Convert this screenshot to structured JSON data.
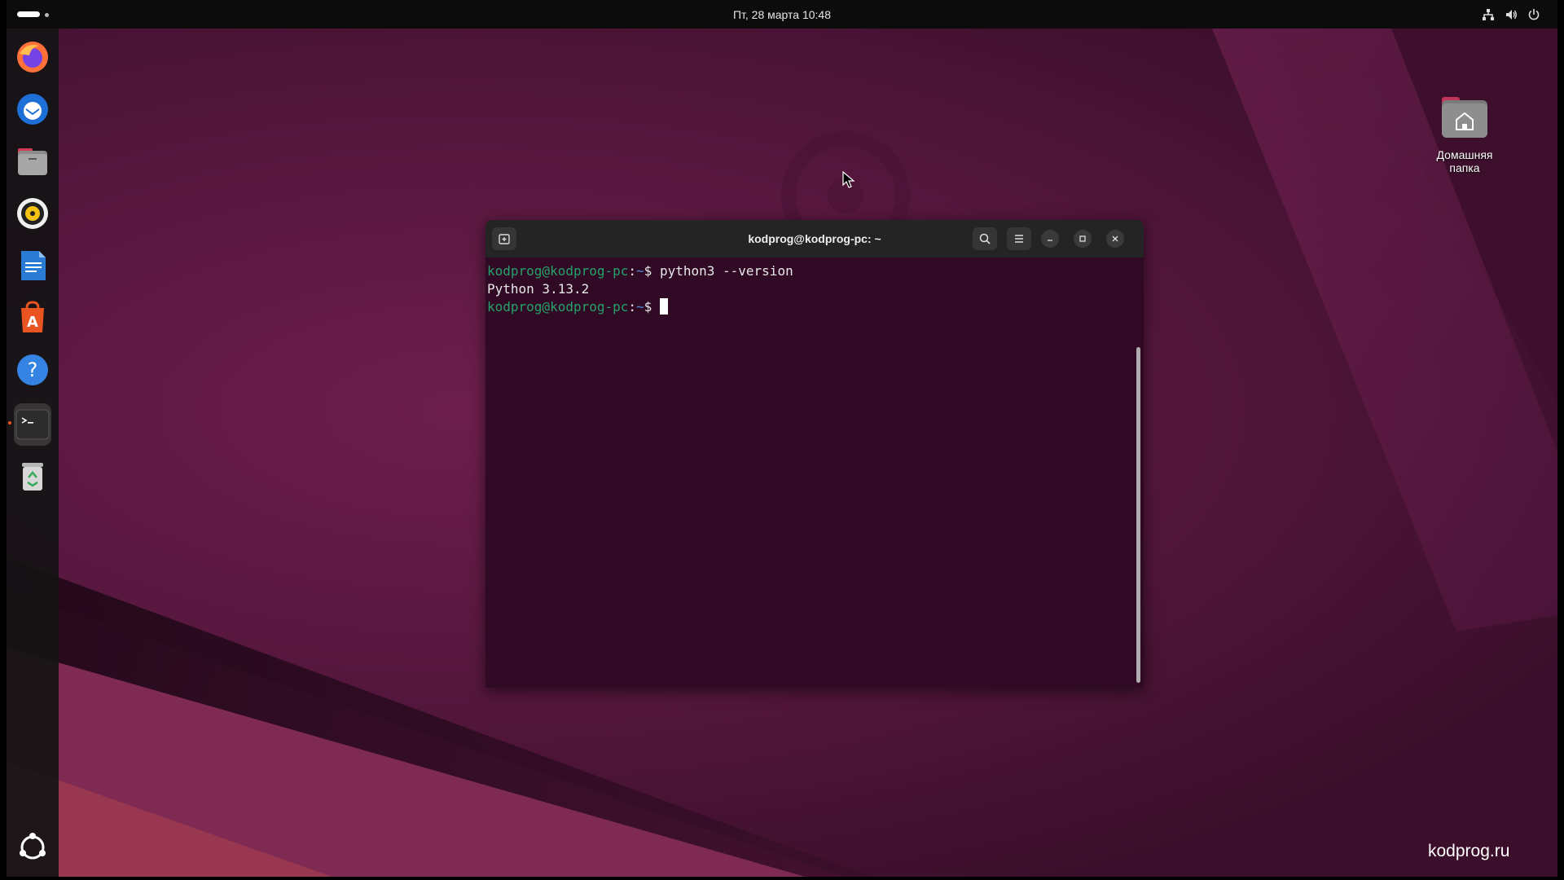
{
  "topbar": {
    "clock": "Пт, 28 марта  10:48",
    "tray_icons": [
      "network-icon",
      "volume-icon",
      "power-icon"
    ]
  },
  "dock": {
    "items": [
      {
        "name": "firefox",
        "icon": "firefox-icon"
      },
      {
        "name": "thunderbird",
        "icon": "thunderbird-icon"
      },
      {
        "name": "files",
        "icon": "files-icon"
      },
      {
        "name": "rhythmbox",
        "icon": "rhythmbox-icon"
      },
      {
        "name": "libreoffice-writer",
        "icon": "writer-icon"
      },
      {
        "name": "app-center",
        "icon": "app-center-icon"
      },
      {
        "name": "help",
        "icon": "help-icon"
      },
      {
        "name": "terminal",
        "icon": "terminal-icon",
        "active": true
      },
      {
        "name": "trash",
        "icon": "trash-icon"
      }
    ],
    "show_apps_icon": "show-apps-icon"
  },
  "desktop": {
    "home_folder_label": "Домашняя папка",
    "watermark": "kodprog.ru"
  },
  "terminal": {
    "title": "kodprog@kodprog-pc: ~",
    "lines": [
      {
        "user": "kodprog@kodprog-pc",
        "sep": ":",
        "path": "~",
        "symbol": "$",
        "command": " python3 --version"
      },
      {
        "output": "Python 3.13.2"
      },
      {
        "user": "kodprog@kodprog-pc",
        "sep": ":",
        "path": "~",
        "symbol": "$",
        "command": " "
      }
    ]
  },
  "colors": {
    "terminal_bg": "#300a24",
    "prompt_user": "#26a269",
    "accent": "#e95420"
  }
}
